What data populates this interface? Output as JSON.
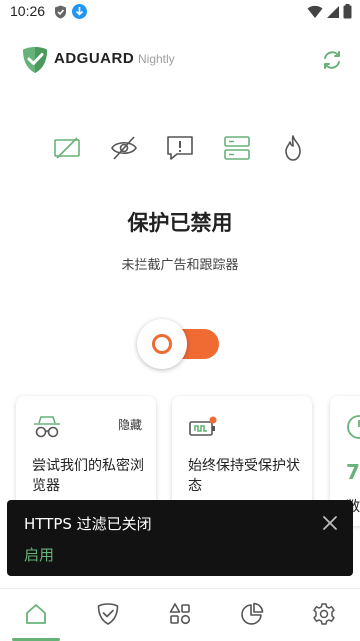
{
  "statusbar": {
    "time": "10:26",
    "icons": [
      "shield-notification-icon",
      "download-notification-icon",
      "wifi-icon",
      "signal-icon",
      "battery-icon"
    ]
  },
  "header": {
    "logo_text": "ADGUARD",
    "logo_sub": "Nightly",
    "refresh_icon": "refresh-icon"
  },
  "features": [
    "ads-blocked-icon",
    "tracking-icon",
    "annoyances-icon",
    "dns-server-icon",
    "firewall-icon"
  ],
  "status": {
    "title": "保护已禁用",
    "subtitle": "未拦截广告和跟踪器"
  },
  "toggle": {
    "state": "off"
  },
  "cards": [
    {
      "icon": "incognito-icon",
      "hide_label": "隐藏",
      "text": "尝试我们的私密浏览器"
    },
    {
      "icon": "battery-bolt-icon",
      "text": "始终保持受保护状态"
    },
    {
      "icon": "clock-icon",
      "number": "7",
      "text": "敞"
    }
  ],
  "snackbar": {
    "message": "HTTPS 过滤已关闭",
    "action": "启用"
  },
  "bottomnav": [
    {
      "name": "home",
      "icon": "home-icon",
      "active": true
    },
    {
      "name": "protection",
      "icon": "shield-check-icon",
      "active": false
    },
    {
      "name": "activity",
      "icon": "apps-icon",
      "active": false
    },
    {
      "name": "statistics",
      "icon": "pie-chart-icon",
      "active": false
    },
    {
      "name": "settings",
      "icon": "gear-icon",
      "active": false
    }
  ],
  "colors": {
    "accent": "#67b279",
    "toggle": "#f06a33",
    "snackbar": "#121212"
  }
}
